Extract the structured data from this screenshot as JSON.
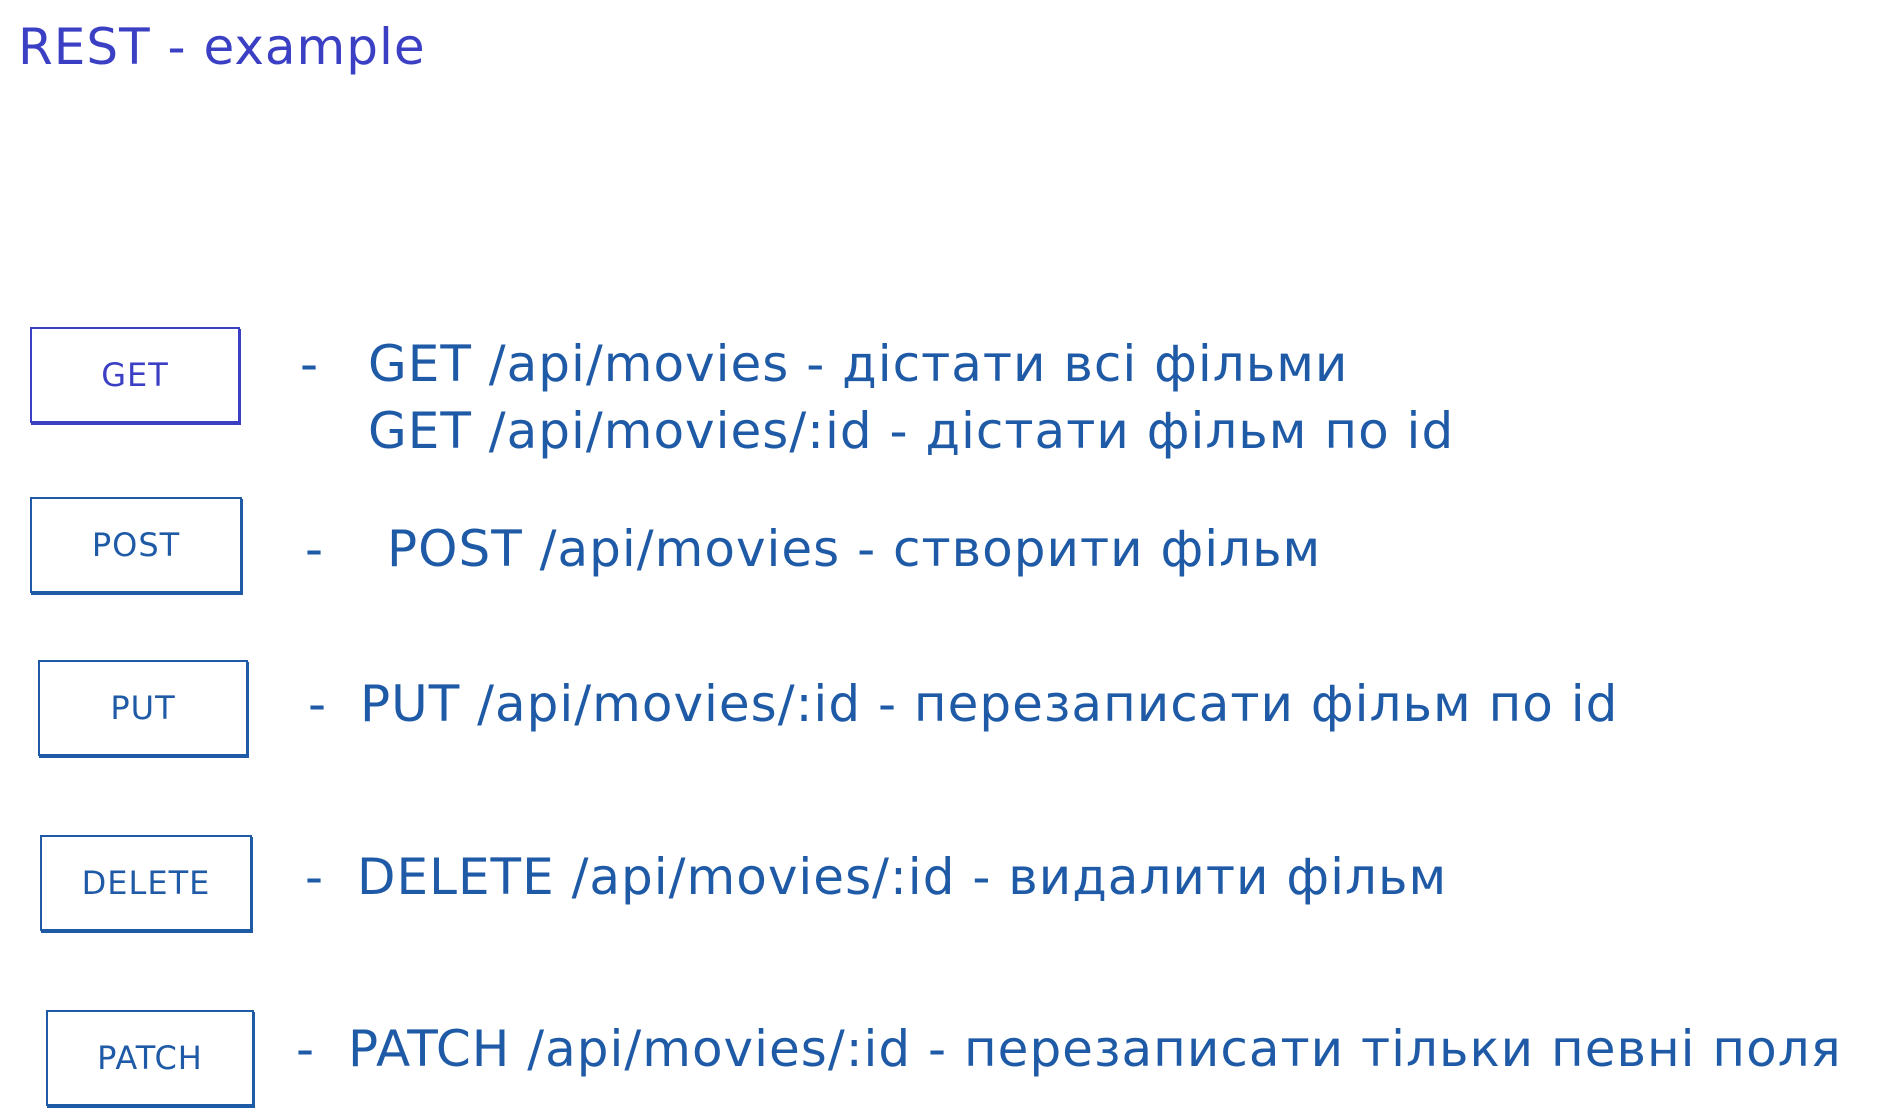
{
  "title": "REST - example",
  "rows": [
    {
      "method": "GET",
      "lines": [
        "GET /api/movies - дістати всі фільми",
        "GET /api/movies/:id - дістати фільм по id"
      ]
    },
    {
      "method": "POST",
      "lines": [
        "POST /api/movies - створити фільм"
      ]
    },
    {
      "method": "PUT",
      "lines": [
        "PUT /api/movies/:id - перезаписати фільм по id"
      ]
    },
    {
      "method": "DELETE",
      "lines": [
        "DELETE /api/movies/:id - видалити фільм"
      ]
    },
    {
      "method": "PATCH",
      "lines": [
        "PATCH /api/movies/:id - перезаписати тільки певні поля"
      ]
    }
  ],
  "colors": {
    "title": "#3a3fc4",
    "ink": "#1f5aa6"
  }
}
